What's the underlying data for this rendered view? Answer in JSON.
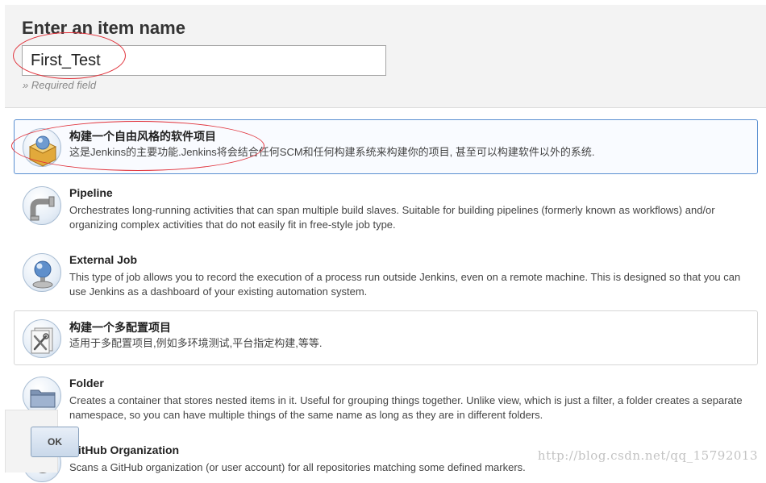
{
  "header": {
    "title": "Enter an item name",
    "name_value": "First_Test",
    "required_note": "» Required field"
  },
  "items": [
    {
      "title": "构建一个自由风格的软件项目",
      "description": "这是Jenkins的主要功能.Jenkins将会结合任何SCM和任何构建系统来构建你的项目, 甚至可以构建软件以外的系统.",
      "icon": "freestyle-box-icon",
      "selected": true
    },
    {
      "title": "Pipeline",
      "description": "Orchestrates long-running activities that can span multiple build slaves. Suitable for building pipelines (formerly known as workflows) and/or organizing complex activities that do not easily fit in free-style job type.",
      "icon": "pipeline-pipe-icon",
      "selected": false
    },
    {
      "title": "External Job",
      "description": "This type of job allows you to record the execution of a process run outside Jenkins, even on a remote machine. This is designed so that you can use Jenkins as a dashboard of your existing automation system.",
      "icon": "external-job-monitor-icon",
      "selected": false
    },
    {
      "title": "构建一个多配置项目",
      "description": "适用于多配置项目,例如多环境测试,平台指定构建,等等.",
      "icon": "multi-config-tools-icon",
      "selected": false
    },
    {
      "title": "Folder",
      "description": "Creates a container that stores nested items in it. Useful for grouping things together. Unlike view, which is just a filter, a folder creates a separate namespace, so you can have multiple things of the same name as long as they are in different folders.",
      "icon": "folder-icon",
      "selected": false
    },
    {
      "title": "GitHub Organization",
      "description": "Scans a GitHub organization (or user account) for all repositories matching some defined markers.",
      "icon": "github-octocat-icon",
      "selected": false
    }
  ],
  "footer": {
    "ok_label": "OK"
  },
  "watermark": "http://blog.csdn.net/qq_15792013",
  "colors": {
    "header_bg": "#f3f3f3",
    "selected_border": "#5a8fd1",
    "annotation_red": "#e0313a"
  }
}
